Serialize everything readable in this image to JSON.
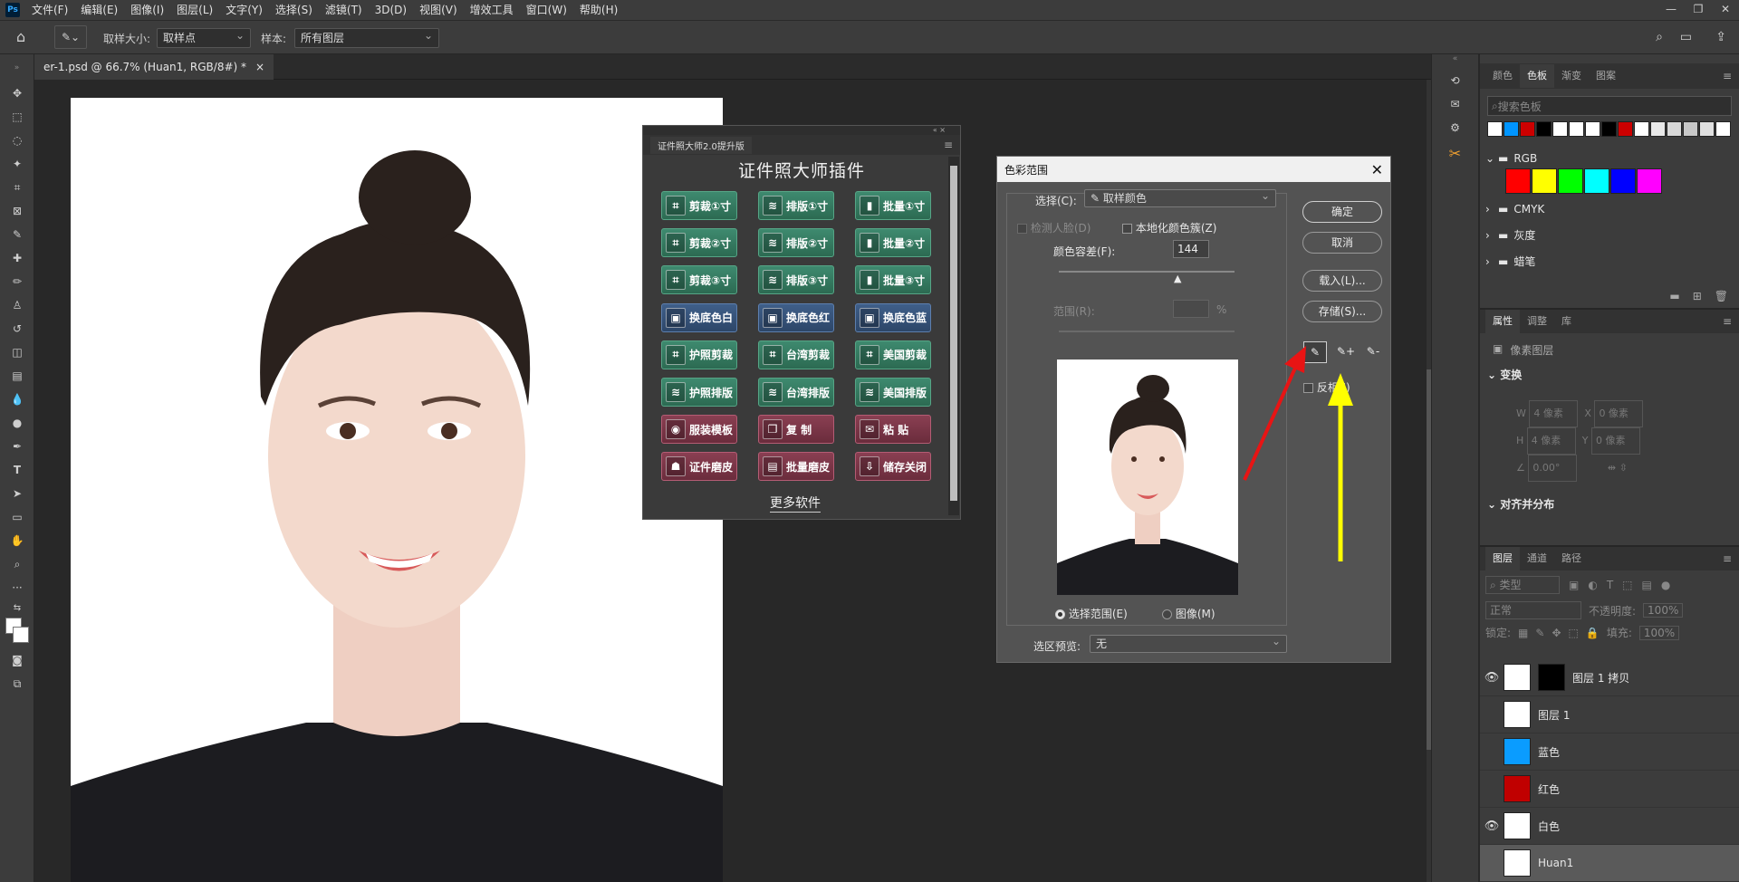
{
  "menu": {
    "items": [
      "文件(F)",
      "编辑(E)",
      "图像(I)",
      "图层(L)",
      "文字(Y)",
      "选择(S)",
      "滤镜(T)",
      "3D(D)",
      "视图(V)",
      "增效工具",
      "窗口(W)",
      "帮助(H)"
    ],
    "logo": "Ps"
  },
  "options": {
    "sample_size_label": "取样大小:",
    "sample_size_value": "取样点",
    "sample_label": "样本:",
    "sample_value": "所有图层"
  },
  "document": {
    "tab_title": "er-1.psd @ 66.7% (Huan1, RGB/8#) *",
    "close": "×"
  },
  "plugin": {
    "tab": "证件照大师2.0提升版",
    "title": "证件照大师插件",
    "more": "更多软件",
    "buttons": [
      {
        "label": "剪裁①寸",
        "style": "g",
        "icon": "⌗"
      },
      {
        "label": "排版①寸",
        "style": "g",
        "icon": "≋"
      },
      {
        "label": "批量①寸",
        "style": "g",
        "icon": "▮"
      },
      {
        "label": "剪裁②寸",
        "style": "g",
        "icon": "⌗"
      },
      {
        "label": "排版②寸",
        "style": "g",
        "icon": "≋"
      },
      {
        "label": "批量②寸",
        "style": "g",
        "icon": "▮"
      },
      {
        "label": "剪裁③寸",
        "style": "g",
        "icon": "⌗"
      },
      {
        "label": "排版③寸",
        "style": "g",
        "icon": "≋"
      },
      {
        "label": "批量③寸",
        "style": "g",
        "icon": "▮"
      },
      {
        "label": "换底色白",
        "style": "b",
        "icon": "▣"
      },
      {
        "label": "换底色红",
        "style": "b",
        "icon": "▣"
      },
      {
        "label": "换底色蓝",
        "style": "b",
        "icon": "▣"
      },
      {
        "label": "护照剪裁",
        "style": "g",
        "icon": "⌗"
      },
      {
        "label": "台湾剪裁",
        "style": "g",
        "icon": "⌗"
      },
      {
        "label": "美国剪裁",
        "style": "g",
        "icon": "⌗"
      },
      {
        "label": "护照排版",
        "style": "g",
        "icon": "≋"
      },
      {
        "label": "台湾排版",
        "style": "g",
        "icon": "≋"
      },
      {
        "label": "美国排版",
        "style": "g",
        "icon": "≋"
      },
      {
        "label": "服装模板",
        "style": "r",
        "icon": "◉"
      },
      {
        "label": "复  制",
        "style": "r",
        "icon": "❐"
      },
      {
        "label": "粘  贴",
        "style": "r",
        "icon": "✉"
      },
      {
        "label": "证件磨皮",
        "style": "r",
        "icon": "☗"
      },
      {
        "label": "批量磨皮",
        "style": "r",
        "icon": "▤"
      },
      {
        "label": "储存关闭",
        "style": "r",
        "icon": "⇩"
      }
    ]
  },
  "color_range": {
    "title": "色彩范围",
    "select_label": "选择(C):",
    "select_value": "取样颜色",
    "detect_faces": "检测人脸(D)",
    "localized": "本地化颜色簇(Z)",
    "fuzziness_label": "颜色容差(F):",
    "fuzziness_value": "144",
    "range_label": "范围(R):",
    "range_unit": "%",
    "ok": "确定",
    "cancel": "取消",
    "load": "载入(L)...",
    "save": "存储(S)...",
    "invert": "反相(I)",
    "radio_selection": "选择范围(E)",
    "radio_image": "图像(M)",
    "preview_label": "选区预览:",
    "preview_value": "无"
  },
  "swatches": {
    "tabs": [
      "颜色",
      "色板",
      "渐变",
      "图案"
    ],
    "active_tab": "色板",
    "search_placeholder": "搜索色板",
    "recent": [
      "#ffffff",
      "#0095ff",
      "#cc0000",
      "#000000",
      "#ffffff",
      "#ffffff",
      "#ffffff",
      "#000000",
      "#cc0000",
      "#ffffff",
      "#e8e8e8",
      "#d8d8d8",
      "#c8c8c8",
      "#e0e0e0",
      "#ffffff"
    ],
    "groups": [
      "RGB",
      "CMYK",
      "灰度",
      "蜡笔"
    ],
    "rgb": [
      "#ff0000",
      "#ffff00",
      "#00ff00",
      "#00ffff",
      "#0000ff",
      "#ff00ff"
    ]
  },
  "properties": {
    "tabs": [
      "属性",
      "调整",
      "库"
    ],
    "type": "像素图层",
    "transform": "变换",
    "w": "W",
    "w_val": "4 像素",
    "x": "X",
    "x_val": "0 像素",
    "h": "H",
    "h_val": "4 像素",
    "y": "Y",
    "y_val": "0 像素",
    "angle": "0.00°",
    "align": "对齐并分布"
  },
  "layers": {
    "tabs": [
      "图层",
      "通道",
      "路径"
    ],
    "filter": "类型",
    "blend": "正常",
    "opacity_label": "不透明度:",
    "opacity": "100%",
    "lock_label": "锁定:",
    "fill_label": "填充:",
    "fill": "100%",
    "items": [
      {
        "name": "图层 1 拷贝",
        "visible": "👁",
        "thumb": "#ffffff"
      },
      {
        "name": "图层 1",
        "visible": "",
        "thumb": "#ffffff"
      },
      {
        "name": "蓝色",
        "visible": "",
        "thumb": "#0a9cff"
      },
      {
        "name": "红色",
        "visible": "",
        "thumb": "#c00000"
      },
      {
        "name": "白色",
        "visible": "👁",
        "thumb": "#ffffff"
      },
      {
        "name": "Huan1",
        "visible": "",
        "thumb": "#ffffff"
      }
    ]
  }
}
